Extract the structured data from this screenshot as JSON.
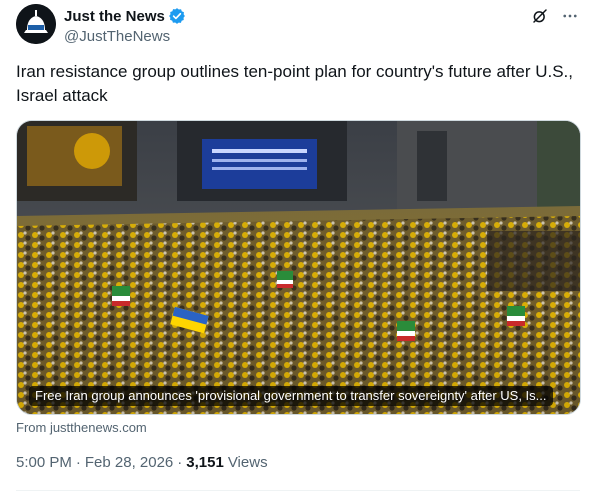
{
  "author": {
    "display_name": "Just the News",
    "handle": "@JustTheNews",
    "verified": true
  },
  "tweet": {
    "text": "Iran resistance group outlines ten-point plan for country's future after U.S., Israel attack"
  },
  "card": {
    "caption": "Free Iran group announces 'provisional government to transfer sovereignty' after US, Is...",
    "source": "From justthenews.com"
  },
  "meta": {
    "time": "5:00 PM",
    "date": "Feb 28, 2026",
    "separator": "·",
    "views_count": "3,151",
    "views_label": "Views"
  },
  "icons": {
    "verified": "verified-badge-icon",
    "grok": "grok-icon",
    "more": "more-icon"
  },
  "colors": {
    "text_primary": "#0f1419",
    "text_secondary": "#536471",
    "verified_blue": "#1d9bf0",
    "border": "#cfd9de"
  }
}
